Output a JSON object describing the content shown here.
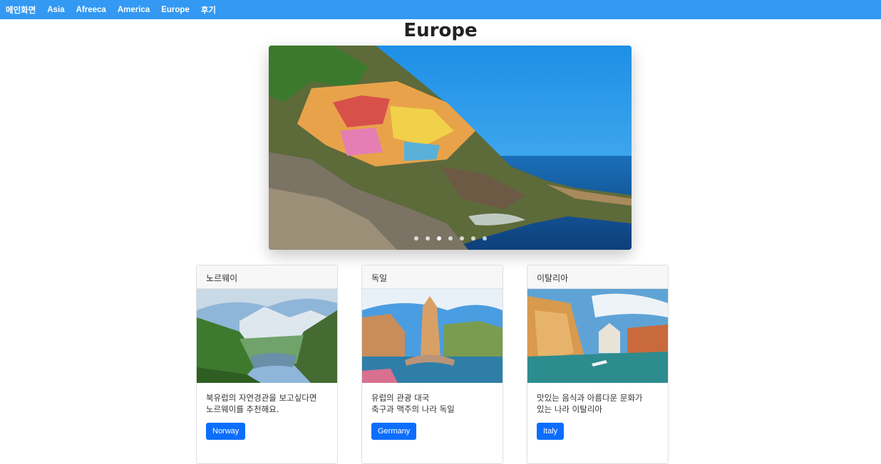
{
  "nav": {
    "home": "메인화면",
    "asia": "Asia",
    "africa": "Afreeca",
    "america": "America",
    "europe": "Europe",
    "review": "후기"
  },
  "page_title": "Europe",
  "carousel": {
    "slide_count": 7,
    "active_index": 2
  },
  "cards": [
    {
      "header": "노르웨이",
      "line1": "북유럽의 자연경관을 보고싶다면",
      "line2": "노르웨이를 추천해요.",
      "button": "Norway"
    },
    {
      "header": "독일",
      "line1": "유럽의 관광 대국",
      "line2": "축구과 맥주의 나라 독일",
      "button": "Germany"
    },
    {
      "header": "이탈리아",
      "line1": "맛있는 음식과 아름다운 문화가",
      "line2": "있는 나라 이탈리아",
      "button": "Italy"
    }
  ]
}
